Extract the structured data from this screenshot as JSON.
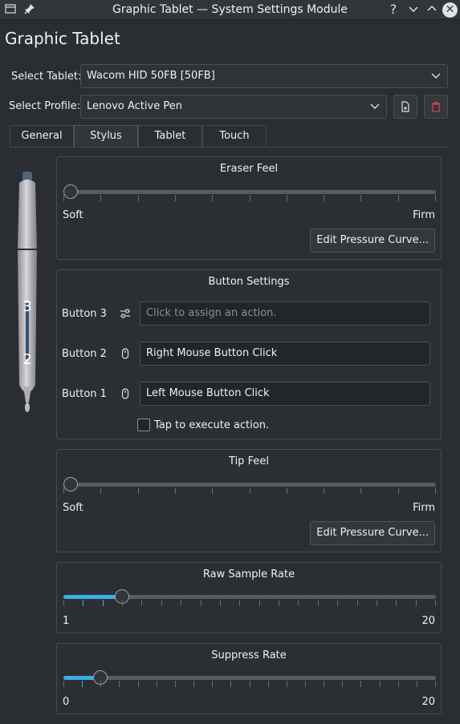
{
  "window": {
    "title": "Graphic Tablet — System Settings Module",
    "help_glyph": "?",
    "minimize_glyph": "⌄",
    "maximize_glyph": "⌃",
    "close_glyph": "✕"
  },
  "page": {
    "title": "Graphic Tablet"
  },
  "tablet_select": {
    "label": "Select Tablet:",
    "value": "Wacom HID 50FB [50FB]"
  },
  "profile_select": {
    "label": "Select Profile:",
    "value": "Lenovo Active Pen"
  },
  "tabs": [
    {
      "label": "General",
      "active": false
    },
    {
      "label": "Stylus",
      "active": true
    },
    {
      "label": "Tablet",
      "active": false
    },
    {
      "label": "Touch",
      "active": false
    }
  ],
  "pen": {
    "marker_upper": "3",
    "marker_lower": "2"
  },
  "eraser_feel": {
    "title": "Eraser Feel",
    "min_label": "Soft",
    "max_label": "Firm",
    "value": 0,
    "edit_button": "Edit Pressure Curve..."
  },
  "button_settings": {
    "title": "Button Settings",
    "rows": [
      {
        "label": "Button 3",
        "icon": "sliders-icon",
        "value": "",
        "placeholder": "Click to assign an action."
      },
      {
        "label": "Button 2",
        "icon": "mouse-icon",
        "value": "Right Mouse Button Click",
        "placeholder": ""
      },
      {
        "label": "Button 1",
        "icon": "mouse-icon",
        "value": "Left Mouse Button Click",
        "placeholder": ""
      }
    ],
    "tap_label": "Tap to execute action.",
    "tap_checked": false
  },
  "tip_feel": {
    "title": "Tip Feel",
    "min_label": "Soft",
    "max_label": "Firm",
    "value": 0,
    "edit_button": "Edit Pressure Curve..."
  },
  "raw_sample_rate": {
    "title": "Raw Sample Rate",
    "min_label": "1",
    "max_label": "20",
    "min": 1,
    "max": 20,
    "value": 4
  },
  "suppress_rate": {
    "title": "Suppress Rate",
    "min_label": "0",
    "max_label": "20",
    "min": 0,
    "max": 20,
    "value": 2
  },
  "colors": {
    "accent": "#3daee9",
    "background": "#2a2e32",
    "delete": "#da4453"
  }
}
